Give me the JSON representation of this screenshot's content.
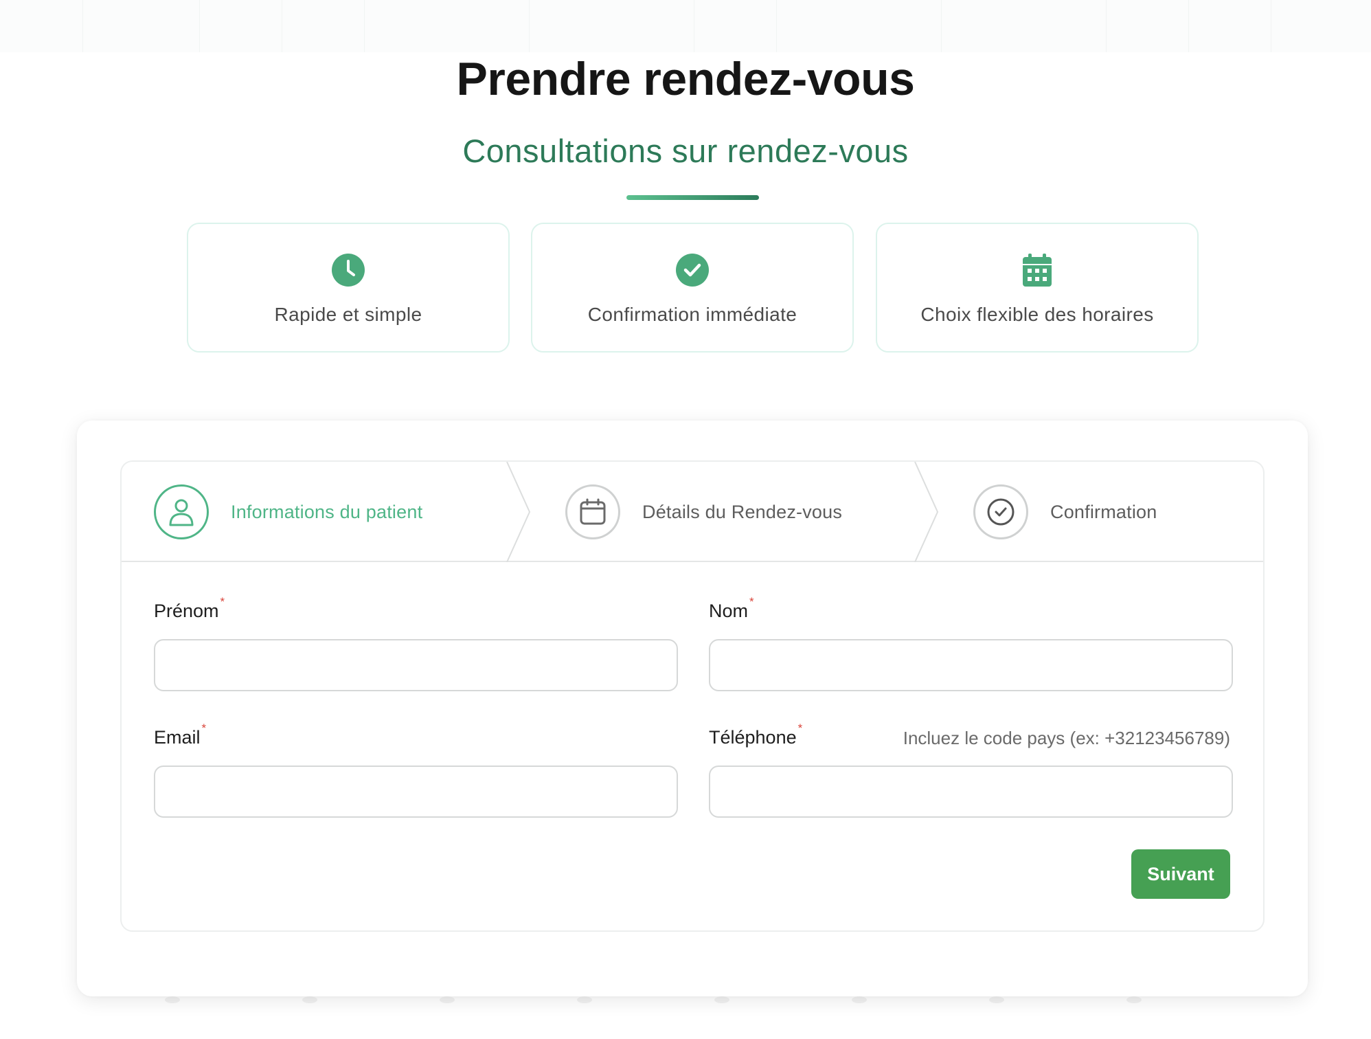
{
  "header": {
    "title": "Prendre rendez-vous",
    "subtitle": "Consultations sur rendez-vous"
  },
  "features": [
    {
      "label": "Rapide et simple",
      "icon": "clock-icon"
    },
    {
      "label": "Confirmation immédiate",
      "icon": "check-circle-icon"
    },
    {
      "label": "Choix flexible des horaires",
      "icon": "calendar-icon"
    }
  ],
  "steps": [
    {
      "label": "Informations du patient",
      "icon": "user-icon",
      "state": "active"
    },
    {
      "label": "Détails du Rendez-vous",
      "icon": "calendar-icon",
      "state": "inactive"
    },
    {
      "label": "Confirmation",
      "icon": "check-circle-icon",
      "state": "inactive"
    }
  ],
  "form": {
    "first_name": {
      "label": "Prénom",
      "required": "*",
      "value": ""
    },
    "last_name": {
      "label": "Nom",
      "required": "*",
      "value": ""
    },
    "email": {
      "label": "Email",
      "required": "*",
      "value": ""
    },
    "phone": {
      "label": "Téléphone",
      "required": "*",
      "value": "",
      "hint": "Incluez le code pays (ex: +32123456789)"
    },
    "next_label": "Suivant"
  },
  "colors": {
    "brand_green": "#4fb587",
    "subtitle_green": "#2d7a58",
    "button_green": "#46a053",
    "required_red": "#d9443a"
  }
}
